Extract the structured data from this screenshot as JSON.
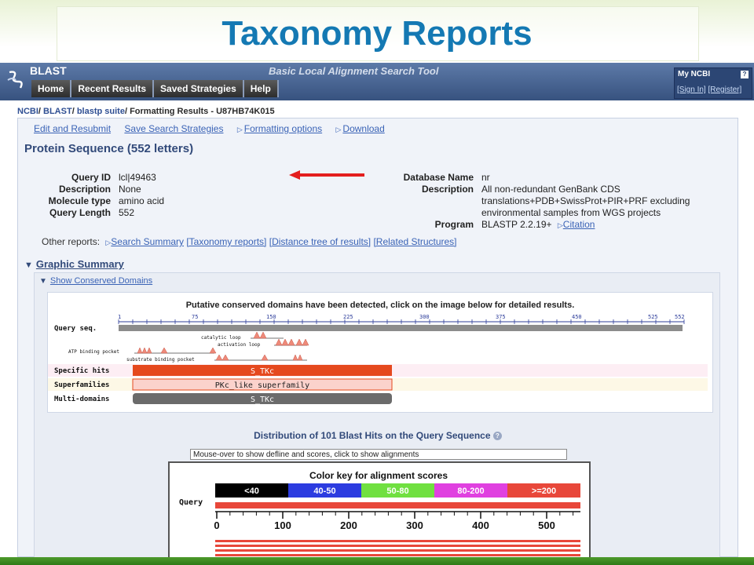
{
  "slide": {
    "title": "Taxonomy Reports"
  },
  "header": {
    "app_name": "BLAST",
    "tagline": "Basic Local Alignment Search Tool",
    "nav": [
      "Home",
      "Recent Results",
      "Saved Strategies",
      "Help"
    ],
    "my_ncbi": {
      "title": "My NCBI",
      "help": "?",
      "sign_in": "[Sign In]",
      "register": "[Register]"
    }
  },
  "breadcrumb": {
    "ncbi": "NCBI",
    "blast": "BLAST",
    "suite": "blastp suite",
    "page": "Formatting Results - U87HB74K015"
  },
  "actions": {
    "edit": "Edit and Resubmit",
    "save": "Save Search Strategies",
    "formatting": "Formatting options",
    "download": "Download"
  },
  "sequence_title": "Protein Sequence (552 letters)",
  "query_info": [
    {
      "label": "Query ID",
      "value": "lcl|49463"
    },
    {
      "label": "Description",
      "value": "None"
    },
    {
      "label": "Molecule type",
      "value": "amino acid"
    },
    {
      "label": "Query Length",
      "value": "552"
    }
  ],
  "db_info": {
    "db_name_label": "Database Name",
    "db_name": "nr",
    "description_label": "Description",
    "description_lines": [
      "All non-redundant GenBank CDS",
      "translations+PDB+SwissProt+PIR+PRF excluding",
      "environmental samples from WGS projects"
    ],
    "program_label": "Program",
    "program": "BLASTP 2.2.19+",
    "citation": "Citation"
  },
  "other_reports": {
    "label": "Other reports:",
    "search_summary": "Search Summary",
    "taxonomy": "[Taxonomy reports]",
    "distance_tree": "[Distance tree of results]",
    "related_structures": "[Related Structures]"
  },
  "graphic_summary": {
    "title": "Graphic Summary",
    "show_cd": "Show Conserved Domains",
    "cd_note": "Putative conserved domains have been detected, click on the image below for detailed results.",
    "ruler_ticks": [
      "1",
      "75",
      "150",
      "225",
      "300",
      "375",
      "450",
      "525",
      "552"
    ],
    "row_labels": {
      "query": "Query seq.",
      "specific": "Specific hits",
      "superfamilies": "Superfamilies",
      "multi": "Multi-domains"
    },
    "features": [
      "catalytic loop",
      "activation loop",
      "ATP binding pocket",
      "substrate binding pocket"
    ],
    "domains": {
      "specific": "S_TKc",
      "superfamily": "PKc_like superfamily",
      "multi": "S_TKc"
    }
  },
  "distribution": {
    "title": "Distribution of 101 Blast Hits on the Query Sequence",
    "mouse_hint": "Mouse-over to show defline and scores, click to show alignments",
    "color_key_title": "Color key for alignment scores",
    "color_key": [
      {
        "label": "<40",
        "color": "#000000"
      },
      {
        "label": "40-50",
        "color": "#2c3ce0"
      },
      {
        "label": "50-80",
        "color": "#70e040"
      },
      {
        "label": "80-200",
        "color": "#e040e0"
      },
      {
        "label": ">=200",
        "color": "#e8473a"
      }
    ],
    "query_label": "Query",
    "axis_ticks": [
      "0",
      "100",
      "200",
      "300",
      "400",
      "500"
    ]
  }
}
